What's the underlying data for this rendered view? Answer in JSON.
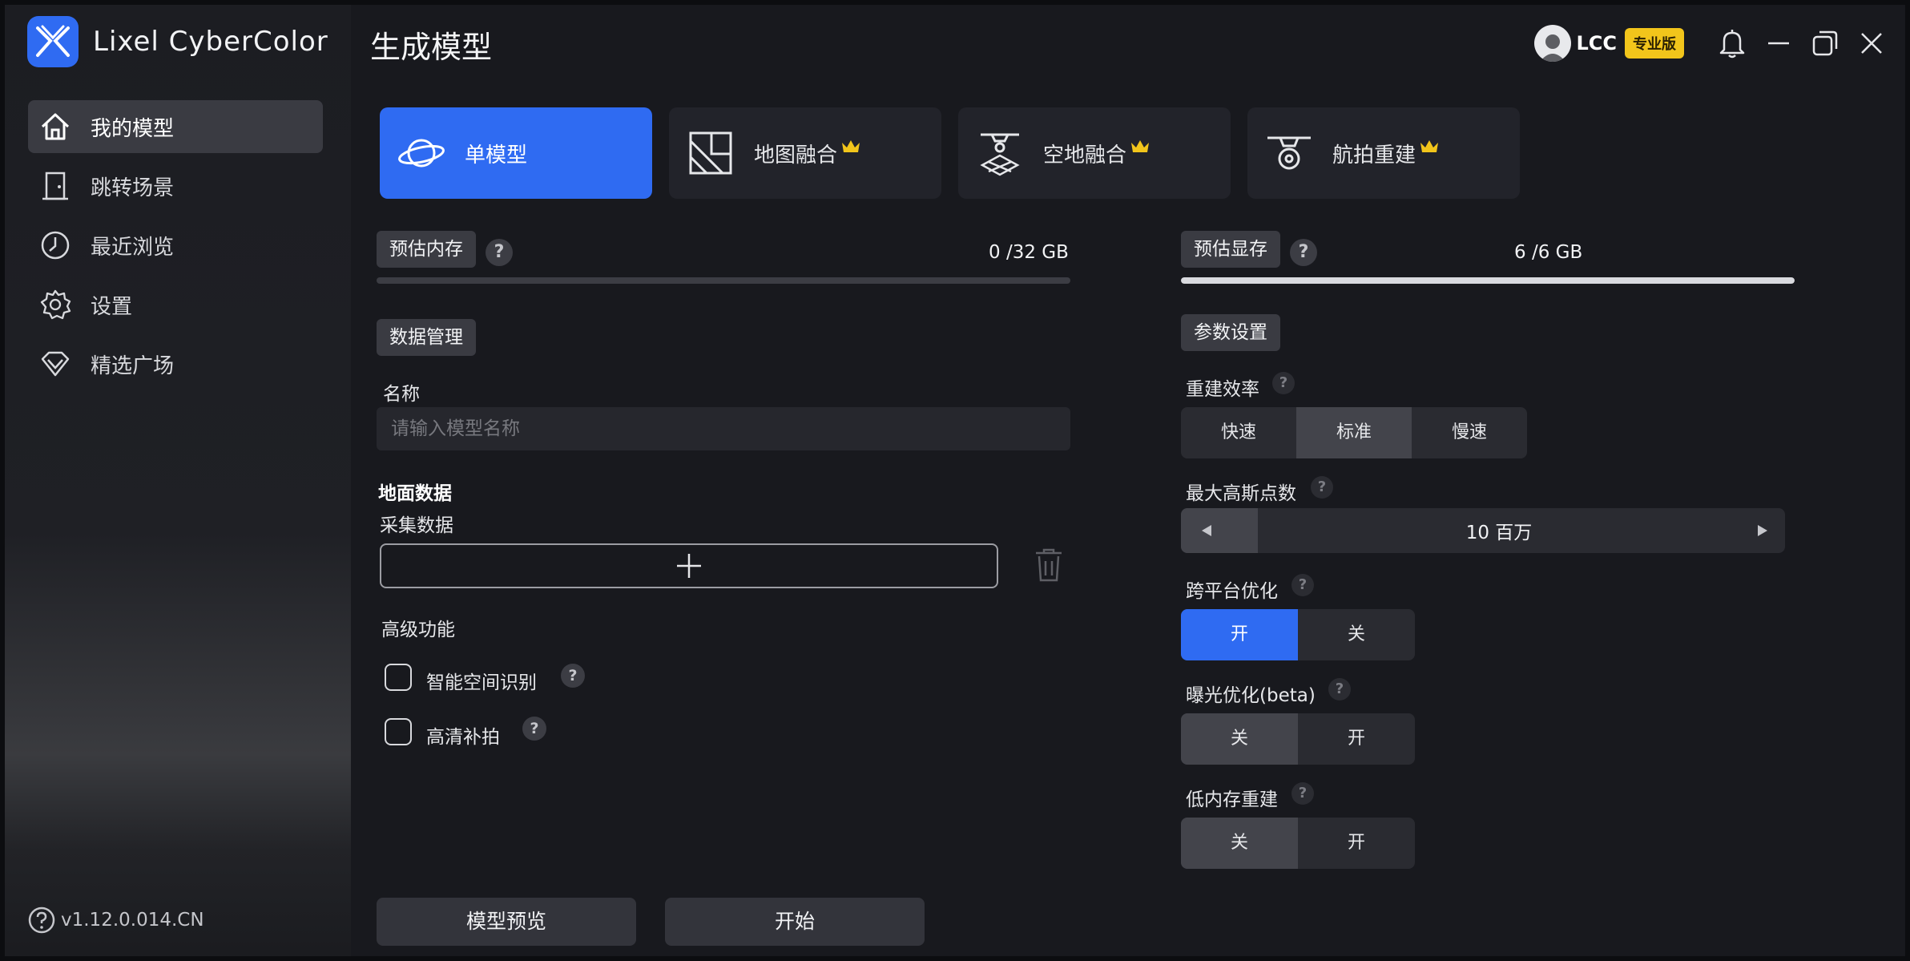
{
  "app": {
    "name": "Lixel CyberColor",
    "version": "v1.12.0.014.CN"
  },
  "sidebar": {
    "items": [
      {
        "label": "我的模型",
        "icon": "home-icon",
        "active": true
      },
      {
        "label": "跳转场景",
        "icon": "door-icon",
        "active": false
      },
      {
        "label": "最近浏览",
        "icon": "clock-icon",
        "active": false
      },
      {
        "label": "设置",
        "icon": "gear-icon",
        "active": false
      },
      {
        "label": "精选广场",
        "icon": "diamond-icon",
        "active": false
      }
    ]
  },
  "header": {
    "title": "生成模型",
    "username": "LCC",
    "badge": "专业版"
  },
  "modes": [
    {
      "label": "单模型",
      "icon": "planet-icon",
      "active": true,
      "premium": false
    },
    {
      "label": "地图融合",
      "icon": "map-icon",
      "active": false,
      "premium": true
    },
    {
      "label": "空地融合",
      "icon": "drone-ground-icon",
      "active": false,
      "premium": true
    },
    {
      "label": "航拍重建",
      "icon": "drone-icon",
      "active": false,
      "premium": true
    }
  ],
  "memory": {
    "label": "预估内存",
    "text": "0 /32 GB",
    "fill": 0.0
  },
  "vram": {
    "label": "预估显存",
    "text": "6 /6 GB",
    "fill": 1.0
  },
  "data_mgmt": {
    "title": "数据管理",
    "name_label": "名称",
    "name_placeholder": "请输入模型名称",
    "ground_title": "地面数据",
    "collect_label": "采集数据"
  },
  "advanced": {
    "title": "高级功能",
    "options": [
      {
        "label": "智能空间识别",
        "checked": false
      },
      {
        "label": "高清补拍",
        "checked": false
      }
    ]
  },
  "params": {
    "title": "参数设置",
    "efficiency": {
      "label": "重建效率",
      "options": [
        "快速",
        "标准",
        "慢速"
      ],
      "selected": 1
    },
    "max_gauss": {
      "label": "最大高斯点数",
      "value": "10 百万"
    },
    "cross_platform": {
      "label": "跨平台优化",
      "options": [
        "开",
        "关"
      ],
      "selected": 0
    },
    "exposure": {
      "label": "曝光优化(beta)",
      "options": [
        "关",
        "开"
      ],
      "selected": 0
    },
    "low_memory": {
      "label": "低内存重建",
      "options": [
        "关",
        "开"
      ],
      "selected": 0
    }
  },
  "actions": {
    "preview": "模型预览",
    "start": "开始"
  },
  "colors": {
    "accent": "#2f6bf2",
    "badge": "#f2c51b",
    "crown": "#f2c51b"
  }
}
